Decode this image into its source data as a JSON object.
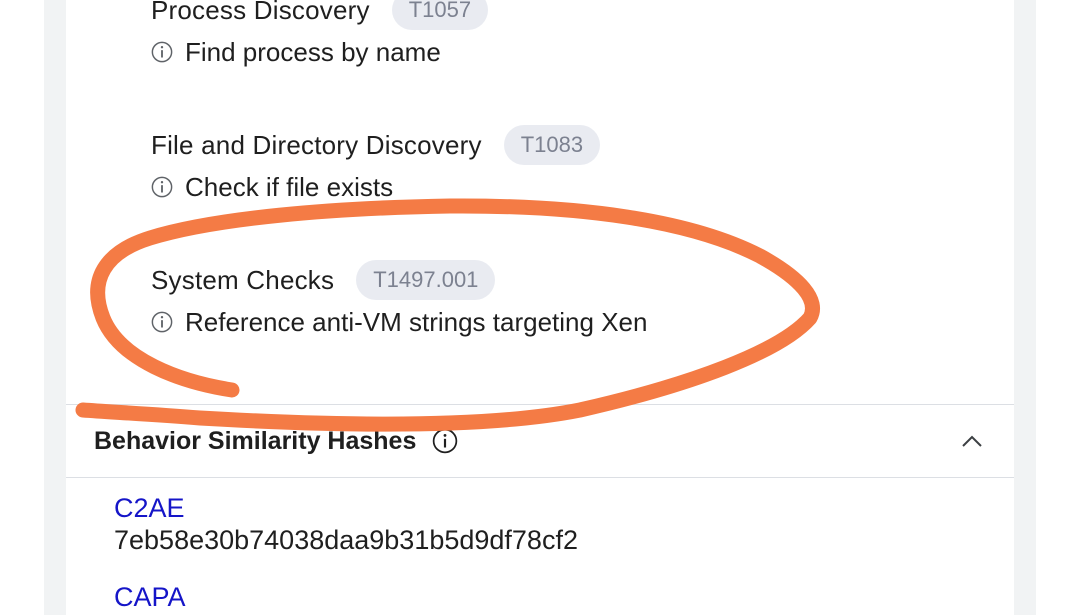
{
  "techniques": [
    {
      "name": "Process Discovery",
      "id": "T1057",
      "description": "Find process by name"
    },
    {
      "name": "File and Directory Discovery",
      "id": "T1083",
      "description": "Check if file exists"
    },
    {
      "name": "System Checks",
      "id": "T1497.001",
      "description": "Reference anti-VM strings targeting Xen"
    }
  ],
  "behavior_section": {
    "title": "Behavior Similarity Hashes",
    "hashes": [
      {
        "name": "C2AE",
        "value": "7eb58e30b74038daa9b31b5d9df78cf2"
      },
      {
        "name": "CAPA",
        "value": ""
      }
    ]
  },
  "colors": {
    "annotation_stroke": "#f47b45",
    "hash_link": "#1515c8",
    "badge_bg": "#e9ebf1"
  },
  "icons": {
    "info": "info-icon",
    "collapse": "chevron-up-icon"
  }
}
